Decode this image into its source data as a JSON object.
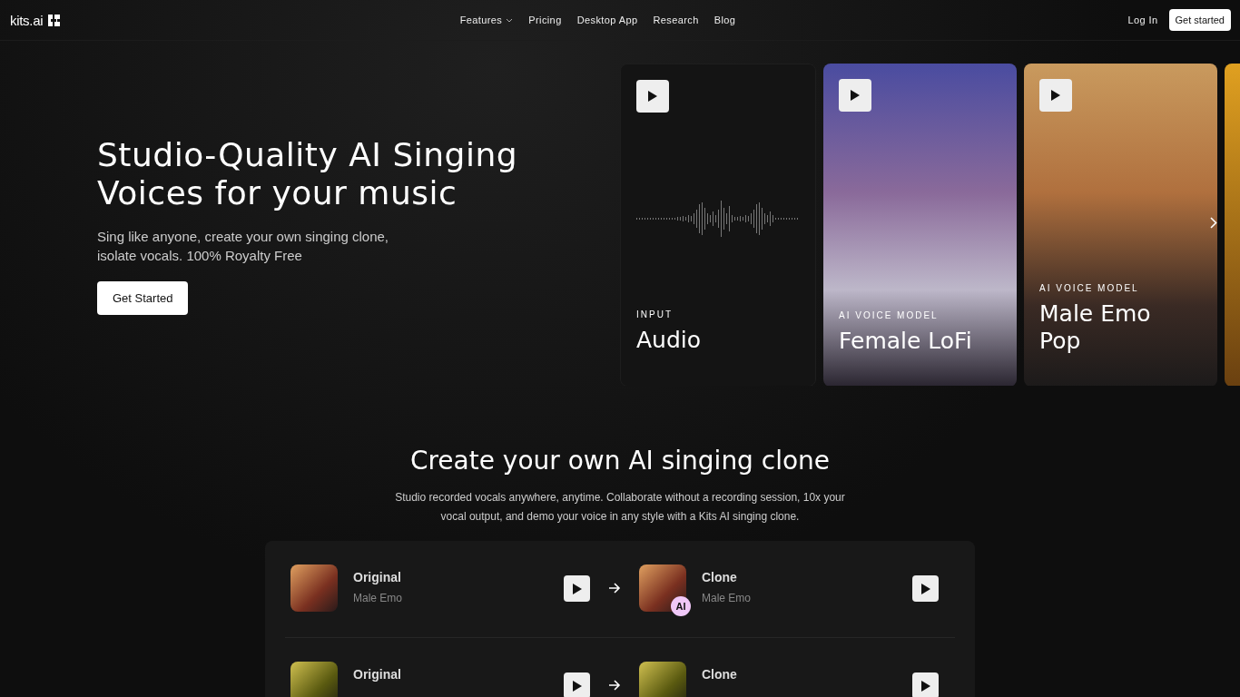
{
  "nav": {
    "logo": "kits.ai",
    "links": [
      {
        "label": "Features",
        "dropdown": true
      },
      {
        "label": "Pricing",
        "dropdown": false
      },
      {
        "label": "Desktop App",
        "dropdown": false
      },
      {
        "label": "Research",
        "dropdown": false
      },
      {
        "label": "Blog",
        "dropdown": false
      }
    ],
    "login": "Log In",
    "cta": "Get started"
  },
  "hero": {
    "title_lines": [
      "Studio-Quality AI Singing",
      "Voices for your music"
    ],
    "subtitle_lines": [
      "Sing like anyone, create your own singing clone,",
      "isolate vocals. 100% Royalty Free"
    ],
    "button": "Get Started"
  },
  "cards": [
    {
      "kind": "waveform",
      "label": "INPUT",
      "title": "Audio"
    },
    {
      "kind": "photo",
      "label": "AI VOICE MODEL",
      "title": "Female LoFi"
    },
    {
      "kind": "photo",
      "label": "AI VOICE MODEL",
      "title": "Male Emo Pop"
    },
    {
      "kind": "photo"
    }
  ],
  "clone_section": {
    "heading": "Create your own AI singing clone",
    "text_lines": [
      "Studio recorded vocals anywhere, anytime. Collaborate without a recording session, 10x your",
      "vocal output, and demo your voice in any style with a Kits AI singing clone."
    ],
    "rows": [
      {
        "original": {
          "title": "Original",
          "subtitle": "Male Emo"
        },
        "clone": {
          "title": "Clone",
          "subtitle": "Male Emo",
          "badge": "AI"
        }
      },
      {
        "original": {
          "title": "Original"
        },
        "clone": {
          "title": "Clone"
        }
      }
    ]
  }
}
